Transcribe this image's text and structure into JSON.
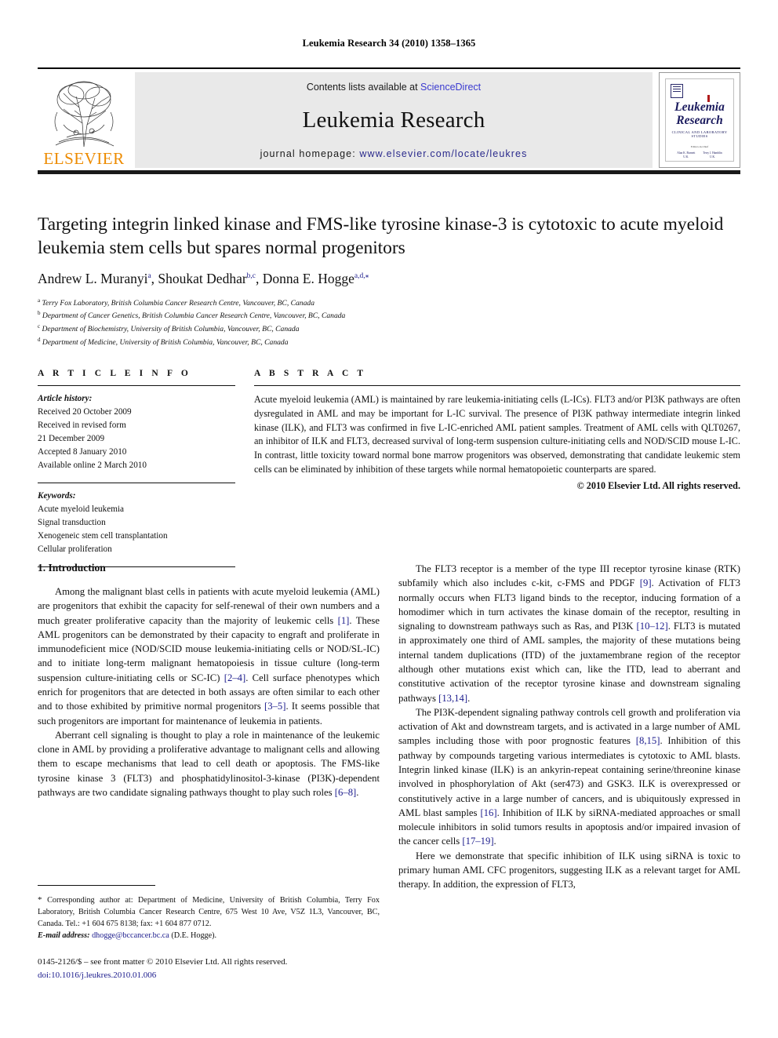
{
  "running_head": "Leukemia Research 34 (2010) 1358–1365",
  "masthead": {
    "publisher": "ELSEVIER",
    "contents_prefix": "Contents lists available at ",
    "sciencedirect": "ScienceDirect",
    "journal_title": "Leukemia Research",
    "homepage_label": "journal homepage: ",
    "homepage_url": "www.elsevier.com/locate/leukres",
    "cover": {
      "title_line1": "Leukemia",
      "title_line2": "Research",
      "subtitle": "Clinical and Laboratory Studies",
      "editors_label": "Editors-in-Chief",
      "editor1": "Alan K. Burnett",
      "editor1_loc": "U.K.",
      "editor2": "Terry J. Hamblin",
      "editor2_loc": "U.K."
    }
  },
  "article": {
    "title": "Targeting integrin linked kinase and FMS-like tyrosine kinase-3 is cytotoxic to acute myeloid leukemia stem cells but spares normal progenitors",
    "authors": [
      {
        "name": "Andrew L. Muranyi",
        "sup": "a"
      },
      {
        "name": "Shoukat Dedhar",
        "sup": "b,c"
      },
      {
        "name": "Donna E. Hogge",
        "sup": "a,d,⁎"
      }
    ],
    "affiliations": [
      {
        "mark": "a",
        "text": "Terry Fox Laboratory, British Columbia Cancer Research Centre, Vancouver, BC, Canada"
      },
      {
        "mark": "b",
        "text": "Department of Cancer Genetics, British Columbia Cancer Research Centre, Vancouver, BC, Canada"
      },
      {
        "mark": "c",
        "text": "Department of Biochemistry, University of British Columbia, Vancouver, BC, Canada"
      },
      {
        "mark": "d",
        "text": "Department of Medicine, University of British Columbia, Vancouver, BC, Canada"
      }
    ]
  },
  "article_info": {
    "heading": "A R T I C L E   I N F O",
    "history_label": "Article history:",
    "history": [
      "Received 20 October 2009",
      "Received in revised form",
      "21 December 2009",
      "Accepted 8 January 2010",
      "Available online 2 March 2010"
    ],
    "keywords_label": "Keywords:",
    "keywords": [
      "Acute myeloid leukemia",
      "Signal transduction",
      "Xenogeneic stem cell transplantation",
      "Cellular proliferation"
    ]
  },
  "abstract": {
    "heading": "A B S T R A C T",
    "text": "Acute myeloid leukemia (AML) is maintained by rare leukemia-initiating cells (L-ICs). FLT3 and/or PI3K pathways are often dysregulated in AML and may be important for L-IC survival. The presence of PI3K pathway intermediate integrin linked kinase (ILK), and FLT3 was confirmed in five L-IC-enriched AML patient samples. Treatment of AML cells with QLT0267, an inhibitor of ILK and FLT3, decreased survival of long-term suspension culture-initiating cells and NOD/SCID mouse L-IC. In contrast, little toxicity toward normal bone marrow progenitors was observed, demonstrating that candidate leukemic stem cells can be eliminated by inhibition of these targets while normal hematopoietic counterparts are spared.",
    "copyright": "© 2010 Elsevier Ltd. All rights reserved."
  },
  "body": {
    "section_heading": "1.  Introduction",
    "left_paragraphs": [
      "Among the malignant blast cells in patients with acute myeloid leukemia (AML) are progenitors that exhibit the capacity for self-renewal of their own numbers and a much greater proliferative capacity than the majority of leukemic cells [1]. These AML progenitors can be demonstrated by their capacity to engraft and proliferate in immunodeficient mice (NOD/SCID mouse leukemia-initiating cells or NOD/SL-IC) and to initiate long-term malignant hematopoiesis in tissue culture (long-term suspension culture-initiating cells or SC-IC) [2–4]. Cell surface phenotypes which enrich for progenitors that are detected in both assays are often similar to each other and to those exhibited by primitive normal progenitors [3–5]. It seems possible that such progenitors are important for maintenance of leukemia in patients.",
      "Aberrant cell signaling is thought to play a role in maintenance of the leukemic clone in AML by providing a proliferative advantage to malignant cells and allowing them to escape mechanisms that lead to cell death or apoptosis. The FMS-like tyrosine kinase 3 (FLT3) and phosphatidylinositol-3-kinase (PI3K)-dependent pathways are two candidate signaling pathways thought to play such roles [6–8]."
    ],
    "right_paragraphs": [
      "The FLT3 receptor is a member of the type III receptor tyrosine kinase (RTK) subfamily which also includes c-kit, c-FMS and PDGF [9]. Activation of FLT3 normally occurs when FLT3 ligand binds to the receptor, inducing formation of a homodimer which in turn activates the kinase domain of the receptor, resulting in signaling to downstream pathways such as Ras, and PI3K [10–12]. FLT3 is mutated in approximately one third of AML samples, the majority of these mutations being internal tandem duplications (ITD) of the juxtamembrane region of the receptor although other mutations exist which can, like the ITD, lead to aberrant and constitutive activation of the receptor tyrosine kinase and downstream signaling pathways [13,14].",
      "The PI3K-dependent signaling pathway controls cell growth and proliferation via activation of Akt and downstream targets, and is activated in a large number of AML samples including those with poor prognostic features [8,15]. Inhibition of this pathway by compounds targeting various intermediates is cytotoxic to AML blasts. Integrin linked kinase (ILK) is an ankyrin-repeat containing serine/threonine kinase involved in phosphorylation of Akt (ser473) and GSK3. ILK is overexpressed or constitutively active in a large number of cancers, and is ubiquitously expressed in AML blast samples [16]. Inhibition of ILK by siRNA-mediated approaches or small molecule inhibitors in solid tumors results in apoptosis and/or impaired invasion of the cancer cells [17–19].",
      "Here we demonstrate that specific inhibition of ILK using siRNA is toxic to primary human AML CFC progenitors, suggesting ILK as a relevant target for AML therapy. In addition, the expression of FLT3,"
    ]
  },
  "footnote": {
    "corresponding": "Corresponding author at: Department of Medicine, University of British Columbia, Terry Fox Laboratory, British Columbia Cancer Research Centre, 675 West 10 Ave, V5Z 1L3, Vancouver, BC, Canada. Tel.: +1 604 675 8138; fax: +1 604 877 0712.",
    "email_label": "E-mail address:",
    "email": "dhogge@bccancer.bc.ca",
    "email_suffix": "(D.E. Hogge).",
    "frontmatter": "0145-2126/$ – see front matter © 2010 Elsevier Ltd. All rights reserved.",
    "doi": "doi:10.1016/j.leukres.2010.01.006"
  },
  "colors": {
    "elsevier_orange": "#ED8B00",
    "link_blue": "#1b1b8c",
    "sciencedirect_blue": "#3a3ad0",
    "banner_gray": "#e9e9e9"
  }
}
